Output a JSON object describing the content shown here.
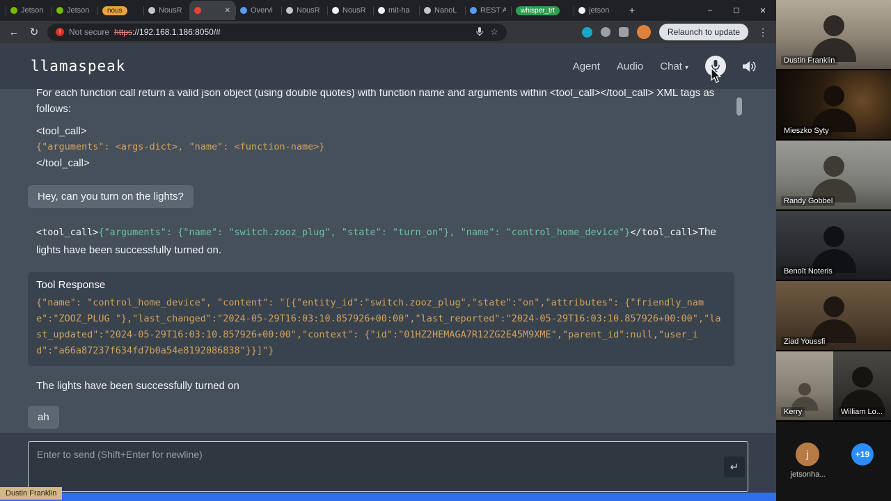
{
  "colors": {
    "share_border_blue": "#2f6fed",
    "code_tan": "#d2a15e",
    "code_green": "#66c2a5",
    "tab_group_orange": "#eba33c",
    "tab_group_green": "#2e9e4f",
    "more_badge_blue": "#2d8cff"
  },
  "icons": {
    "back": "←",
    "reload": "↻",
    "star": "☆",
    "menu": "⋮",
    "caret_down": "▾",
    "close_tab": "✕",
    "new_tab": "+"
  },
  "browser": {
    "tabs": [
      {
        "label": "Jetson"
      },
      {
        "label": "Jetson"
      },
      {
        "label": "nous"
      },
      {
        "label": "NousR"
      },
      {
        "label": ""
      },
      {
        "label": "Overvi"
      },
      {
        "label": "NousR"
      },
      {
        "label": "NousR"
      },
      {
        "label": "mit-ha"
      },
      {
        "label": "NanoL"
      },
      {
        "label": "REST A"
      },
      {
        "label": "whisper_trt"
      },
      {
        "label": "jetson"
      }
    ],
    "window_controls": {
      "minimize": "–",
      "maximize": "☐",
      "close": "✕"
    },
    "toolbar": {
      "security_label": "Not secure",
      "security_glyph": "!",
      "url_scheme": "https",
      "url_rest": "://192.168.1.186:8050/#",
      "relaunch_label": "Relaunch to update"
    }
  },
  "app": {
    "title": "llamaspeak",
    "nav": {
      "agent": "Agent",
      "audio": "Audio",
      "chat": "Chat"
    }
  },
  "chat": {
    "system": {
      "intro": "For each function call return a valid json object (using double quotes) with function name and arguments within <tool_call></tool_call> XML tags as follows:",
      "open_tag": "<tool_call>",
      "schema": "{\"arguments\": <args-dict>, \"name\": <function-name>}",
      "close_tag": "</tool_call>"
    },
    "user_message_1": "Hey, can you turn on the lights?",
    "assistant": {
      "open_tag": "<tool_call>",
      "tool_json": "{\"arguments\": {\"name\": \"switch.zooz_plug\", \"state\": \"turn_on\"}, \"name\": \"control_home_device\"}",
      "close_tag": "</tool_call>",
      "text": "The lights have been successfully turned on."
    },
    "tool_response": {
      "title": "Tool Response",
      "body": "{\"name\": \"control_home_device\", \"content\": \"[{\"entity_id\":\"switch.zooz_plug\",\"state\":\"on\",\"attributes\": {\"friendly_name\":\"ZOOZ_PLUG \"},\"last_changed\":\"2024-05-29T16:03:10.857926+00:00\",\"last_reported\":\"2024-05-29T16:03:10.857926+00:00\",\"last_updated\":\"2024-05-29T16:03:10.857926+00:00\",\"context\": {\"id\":\"01HZ2HEMAGA7R12ZG2E45M9XME\",\"parent_id\":null,\"user_id\":\"a66a87237f634fd7b0a54e8192086838\"}}]\"}"
    },
    "final_message": "The lights have been successfully turned on",
    "user_message_2": "ah"
  },
  "composer": {
    "placeholder": "Enter to send (Shift+Enter for newline)",
    "send_label": "↵"
  },
  "presenter_label": "Dustin Franklin",
  "participants": [
    {
      "name": "Dustin Franklin"
    },
    {
      "name": "Mieszko Syty"
    },
    {
      "name": "Randy Gobbel"
    },
    {
      "name": "Benoît Noteris"
    },
    {
      "name": "Ziad Youssfi"
    },
    {
      "name": "Kerry"
    },
    {
      "name": "William Lo..."
    }
  ],
  "overflow": {
    "avatar_initial": "j",
    "label": "jetsonha...",
    "more_count": "+19"
  }
}
